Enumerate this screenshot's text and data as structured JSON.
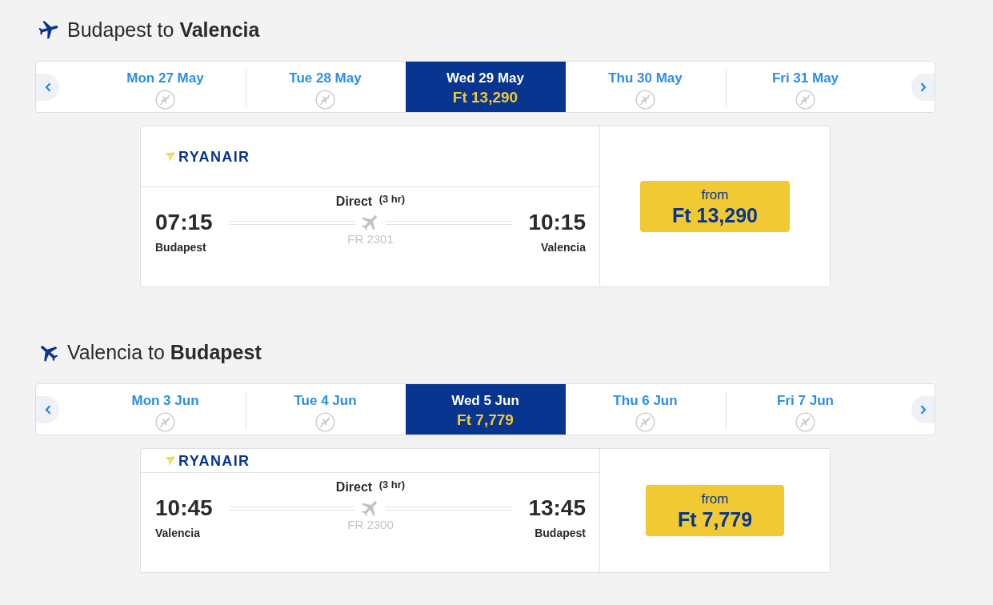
{
  "sections": [
    {
      "title": "Budapest to **Valencia**",
      "days": [
        {
          "label": "Mon 27 May",
          "selected": false,
          "available": false
        },
        {
          "label": "Tue 28 May",
          "selected": false,
          "available": false
        },
        {
          "label": "Wed 29 May",
          "selected": true,
          "available": true,
          "price": "Ft 13,290"
        },
        {
          "label": "Thu 30 May",
          "selected": false,
          "available": false
        },
        {
          "label": "Fri 31 May",
          "selected": false,
          "available": false
        }
      ],
      "flights": [
        {
          "airline": "RYANAIR",
          "departure": {
            "time": "07:15",
            "city": "Budapest"
          },
          "arrival": {
            "time": "10:15",
            "city": "Valencia"
          },
          "stops": "Direct $^{(3 hr)}$",
          "flight_number": "FR 2301",
          "price_label": "from",
          "price": "Ft 13,290"
        }
      ]
    },
    {
      "title": "Valencia to **Budapest**",
      "days": [
        {
          "label": "Mon 3 Jun",
          "selected": false,
          "available": false
        },
        {
          "label": "Tue 4 Jun",
          "selected": false,
          "available": false
        },
        {
          "label": "Wed 5 Jun",
          "selected": true,
          "available": true,
          "price": "Ft 7,779"
        },
        {
          "label": "Thu 6 Jun",
          "selected": false,
          "available": false
        },
        {
          "label": "Fri 7 Jun",
          "selected": false,
          "available": false
        }
      ],
      "flights": [
        {
          "airline": "RYANAIR",
          "departure": {
            "time": "10:45",
            "city": "Valencia"
          },
          "arrival": {
            "time": "13:45",
            "city": "Budapest"
          },
          "stops": "Direct $^{(3 hr)}$",
          "flight_number": "FR 2300",
          "price_label": "from",
          "price": "Ft 7,779"
        }
      ]
    }
  ]
}
